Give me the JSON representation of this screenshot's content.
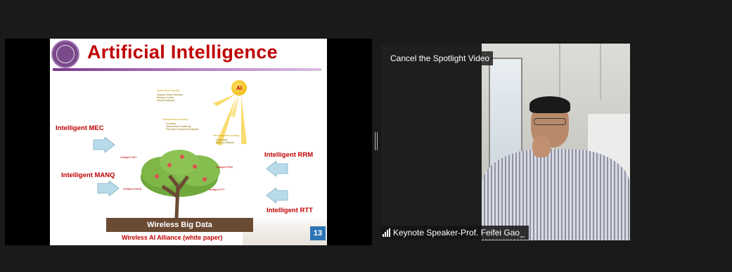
{
  "slide": {
    "title": "Artificial Intelligence",
    "sun_label": "AI",
    "labels": {
      "mec": "Intelligent MEC",
      "manq": "Intelligent MANQ",
      "rrm": "Intelligent RRM",
      "rtt": "Intelligent RTT"
    },
    "learning": {
      "supervised": "Supervised Learning",
      "unsupervised": "Unsupervised Learning",
      "reinforcement": "Reinforcement Learning"
    },
    "ground_text": "Wireless Big Data",
    "slide_number": "13",
    "footer": "Wireless AI Alliance (white paper)"
  },
  "video": {
    "spotlight_button": "Cancel the Spotlight Video",
    "participant_name": "Keynote Speaker-Prof. Feifei Gao_"
  },
  "icons": {
    "signal": "signal-bars-icon",
    "arrow": "arrow-icon",
    "logo": "university-seal"
  }
}
